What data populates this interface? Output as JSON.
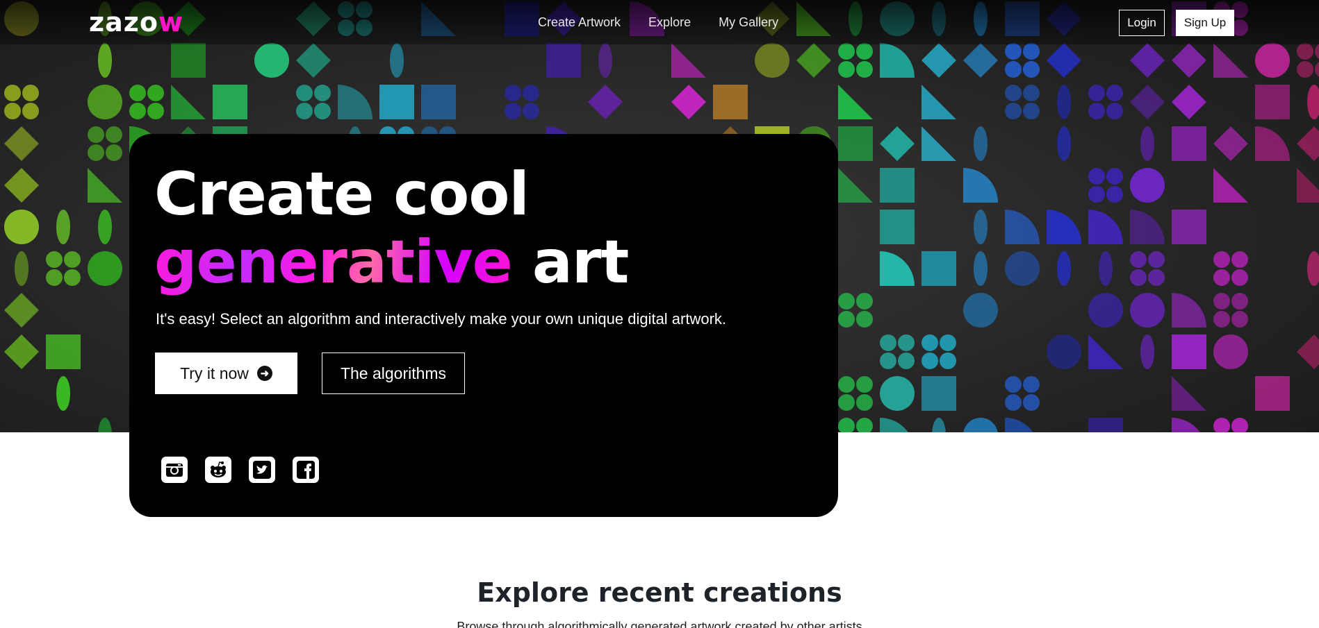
{
  "brand": {
    "logo_main": "zazo",
    "logo_accent": "w",
    "accent_color": "#ff14c8"
  },
  "nav": {
    "links": [
      "Create Artwork",
      "Explore",
      "My Gallery"
    ],
    "login_label": "Login",
    "signup_label": "Sign Up"
  },
  "hero": {
    "headline_line1": "Create cool",
    "headline_highlight": "generative",
    "headline_tail": "art",
    "subtitle": "It's easy! Select an algorithm and interactively make your own unique digital artwork.",
    "primary_button": "Try it now",
    "secondary_button": "The algorithms",
    "socials": [
      "instagram-icon",
      "reddit-icon",
      "twitter-icon",
      "facebook-icon"
    ]
  },
  "explore": {
    "title": "Explore recent creations",
    "subtitle": "Browse through algorithmically generated artwork created by other artists"
  }
}
